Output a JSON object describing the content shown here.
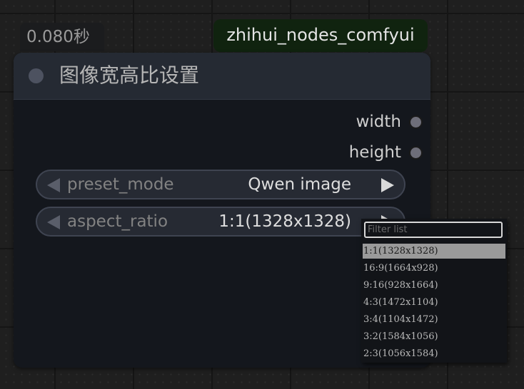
{
  "exec_time": "0.080秒",
  "badge": "zhihui_nodes_comfyui",
  "node": {
    "title": "图像宽高比设置",
    "outputs": [
      "width",
      "height"
    ],
    "widgets": [
      {
        "label": "preset_mode",
        "value": "Qwen image"
      },
      {
        "label": "aspect_ratio",
        "value": "1:1(1328x1328)"
      }
    ]
  },
  "dropdown": {
    "filter_placeholder": "Filter list",
    "selected_index": 0,
    "options": [
      "1:1(1328x1328)",
      "16:9(1664x928)",
      "9:16(928x1664)",
      "4:3(1472x1104)",
      "3:4(1104x1472)",
      "3:2(1584x1056)",
      "2:3(1056x1584)"
    ]
  }
}
